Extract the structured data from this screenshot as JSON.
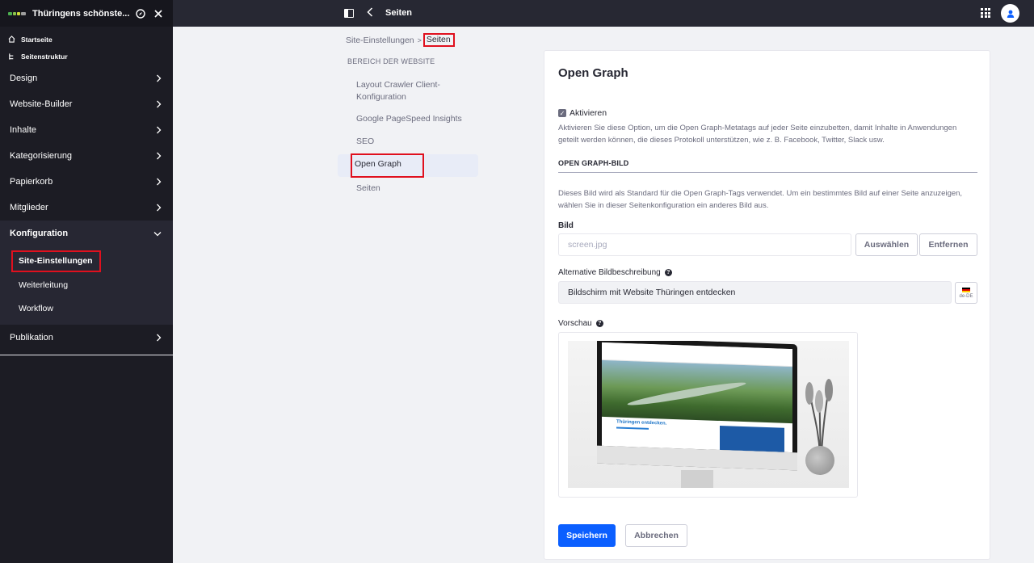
{
  "sidebar": {
    "site_name": "Thüringens schönste...",
    "top_items": [
      {
        "label": "Startseite",
        "icon": "home-icon"
      },
      {
        "label": "Seitenstruktur",
        "icon": "tree-icon"
      }
    ],
    "groups": [
      {
        "label": "Design"
      },
      {
        "label": "Website-Builder"
      },
      {
        "label": "Inhalte"
      },
      {
        "label": "Kategorisierung"
      },
      {
        "label": "Papierkorb"
      },
      {
        "label": "Mitglieder"
      },
      {
        "label": "Konfiguration"
      },
      {
        "label": "Publikation"
      }
    ],
    "config_items": [
      {
        "label": "Site-Einstellungen"
      },
      {
        "label": "Weiterleitung"
      },
      {
        "label": "Workflow"
      }
    ]
  },
  "topbar": {
    "title": "Seiten"
  },
  "breadcrumb": {
    "parent": "Site-Einstellungen",
    "separator": ">",
    "current": "Seiten"
  },
  "nav": {
    "header": "BEREICH DER WEBSITE",
    "items": [
      {
        "label": "Layout Crawler Client-Konfiguration"
      },
      {
        "label": "Google PageSpeed Insights"
      },
      {
        "label": "SEO"
      },
      {
        "label": "Open Graph"
      },
      {
        "label": "Seiten"
      }
    ]
  },
  "card": {
    "title": "Open Graph",
    "enable_label": "Aktivieren",
    "enable_checked": true,
    "enable_help": "Aktivieren Sie diese Option, um die Open Graph-Metatags auf jeder Seite einzubetten, damit Inhalte in Anwendungen geteilt werden können, die dieses Protokoll unterstützen, wie z. B. Facebook, Twitter, Slack usw.",
    "section_title": "OPEN GRAPH-BILD",
    "section_help": "Dieses Bild wird als Standard für die Open Graph-Tags verwendet. Um ein bestimmtes Bild auf einer Seite anzuzeigen, wählen Sie in dieser Seitenkonfiguration ein anderes Bild aus.",
    "image_label": "Bild",
    "image_placeholder": "screen.jpg",
    "select_button": "Auswählen",
    "remove_button": "Entfernen",
    "alt_label": "Alternative Bildbeschreibung",
    "alt_value": "Bildschirm mit Website Thüringen entdecken",
    "lang_code": "de-DE",
    "preview_label": "Vorschau",
    "preview_caption": "Thüringen entdecken.",
    "save_button": "Speichern",
    "cancel_button": "Abbrechen"
  },
  "colors": {
    "primary": "#0b5fff",
    "sidebar_bg": "#1c1c24",
    "highlight_box": "#e0101e"
  }
}
